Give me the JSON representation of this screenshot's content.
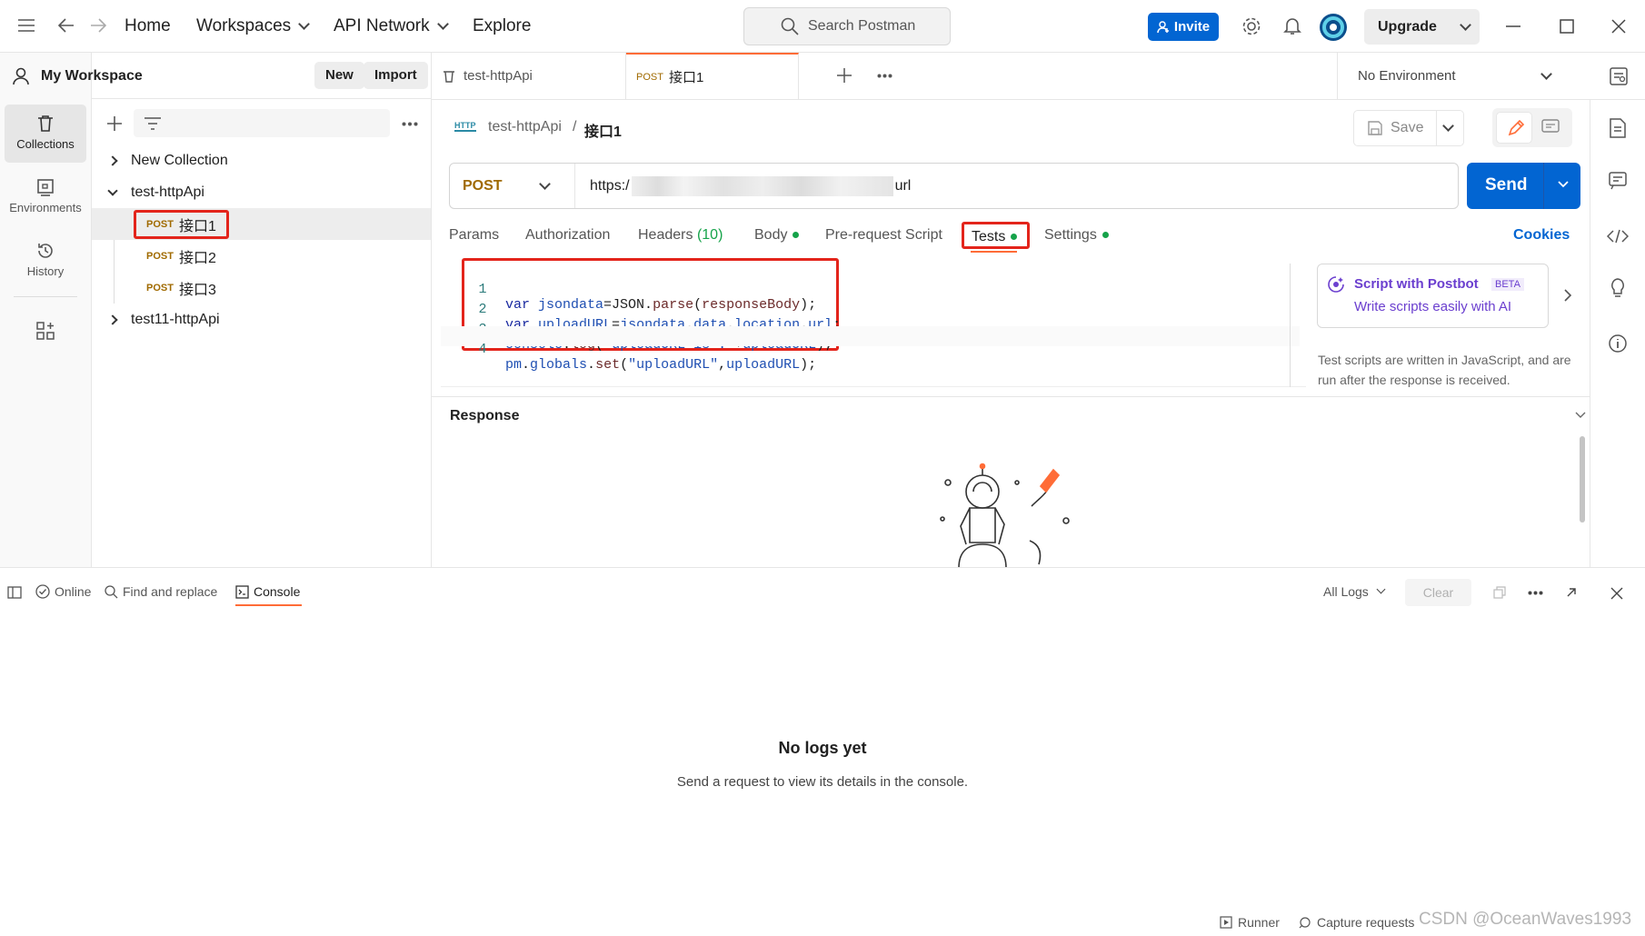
{
  "topbar": {
    "home": "Home",
    "workspaces": "Workspaces",
    "api_network": "API Network",
    "explore": "Explore",
    "search_placeholder": "Search Postman",
    "invite": "Invite",
    "upgrade": "Upgrade"
  },
  "workspace": {
    "name": "My Workspace",
    "new_btn": "New",
    "import_btn": "Import"
  },
  "rail": {
    "collections": "Collections",
    "environments": "Environments",
    "history": "History"
  },
  "tree": {
    "items": [
      {
        "label": "New Collection"
      },
      {
        "label": "test-httpApi"
      },
      {
        "method": "POST",
        "label": "接口1"
      },
      {
        "method": "POST",
        "label": "接口2"
      },
      {
        "method": "POST",
        "label": "接口3"
      },
      {
        "label": "test11-httpApi"
      }
    ]
  },
  "tabs": {
    "tab1": "test-httpApi",
    "tab2_method": "POST",
    "tab2": "接口1",
    "environment": "No Environment"
  },
  "request": {
    "breadcrumb_icon": "HTTP",
    "breadcrumb_collection": "test-httpApi",
    "breadcrumb_sep": "/",
    "breadcrumb_request": "接口1",
    "save": "Save",
    "method": "POST",
    "url_prefix": "https:/",
    "url_suffix": "url",
    "send": "Send",
    "subtabs": {
      "params": "Params",
      "authorization": "Authorization",
      "headers": "Headers",
      "headers_count": "(10)",
      "body": "Body",
      "prerequest": "Pre-request Script",
      "tests": "Tests",
      "settings": "Settings",
      "cookies": "Cookies"
    }
  },
  "editor": {
    "lines": [
      {
        "n": "1"
      },
      {
        "n": "2"
      },
      {
        "n": "3"
      },
      {
        "n": "4"
      }
    ]
  },
  "postbot": {
    "title": "Script with Postbot",
    "badge": "BETA",
    "subtitle": "Write scripts easily with AI",
    "help": "Test scripts are written in JavaScript, and are run after the response is received."
  },
  "response": {
    "title": "Response"
  },
  "console": {
    "online": "Online",
    "find_replace": "Find and replace",
    "console_tab": "Console",
    "all_logs": "All Logs",
    "clear": "Clear",
    "empty_title": "No logs yet",
    "empty_sub": "Send a request to view its details in the console."
  },
  "footer": {
    "runner": "Runner",
    "capture": "Capture requests",
    "watermark": "CSDN @OceanWaves1993"
  },
  "colors": {
    "accent": "#0265d2",
    "method_post": "#a06a00",
    "highlight_box": "#e3241b",
    "active_tab_underline": "#ff6c37",
    "status_dot": "#16a34a"
  }
}
